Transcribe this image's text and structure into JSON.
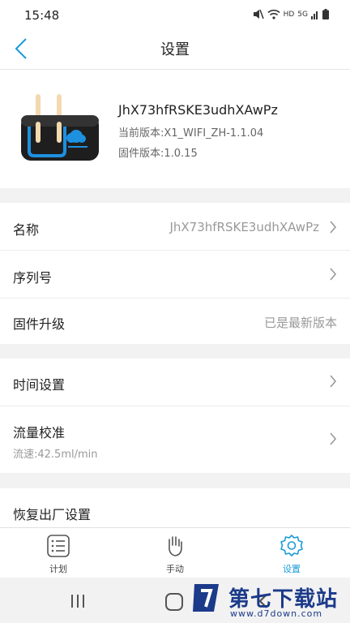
{
  "status_bar": {
    "time": "15:48",
    "network": "HD",
    "signal": "5G"
  },
  "header": {
    "title": "设置"
  },
  "device": {
    "name": "JhX73hfRSKE3udhXAwPz",
    "current_version": "当前版本:X1_WIFI_ZH-1.1.04",
    "firmware_version": "固件版本:1.0.15"
  },
  "settings": {
    "name": {
      "label": "名称",
      "value": "JhX73hfRSKE3udhXAwPz"
    },
    "serial": {
      "label": "序列号"
    },
    "firmware": {
      "label": "固件升级",
      "value": "已是最新版本"
    },
    "time": {
      "label": "时间设置"
    },
    "flow": {
      "label": "流量校准",
      "sub": "流速:42.5ml/min"
    },
    "reset": {
      "label": "恢复出厂设置"
    }
  },
  "tabs": [
    {
      "label": "计划",
      "icon": "list-icon"
    },
    {
      "label": "手动",
      "icon": "hand-icon"
    },
    {
      "label": "设置",
      "icon": "gear-icon"
    }
  ],
  "colors": {
    "accent": "#1a9ad8"
  },
  "watermark": {
    "name": "第七下载站",
    "url": "www.d7down.com"
  }
}
